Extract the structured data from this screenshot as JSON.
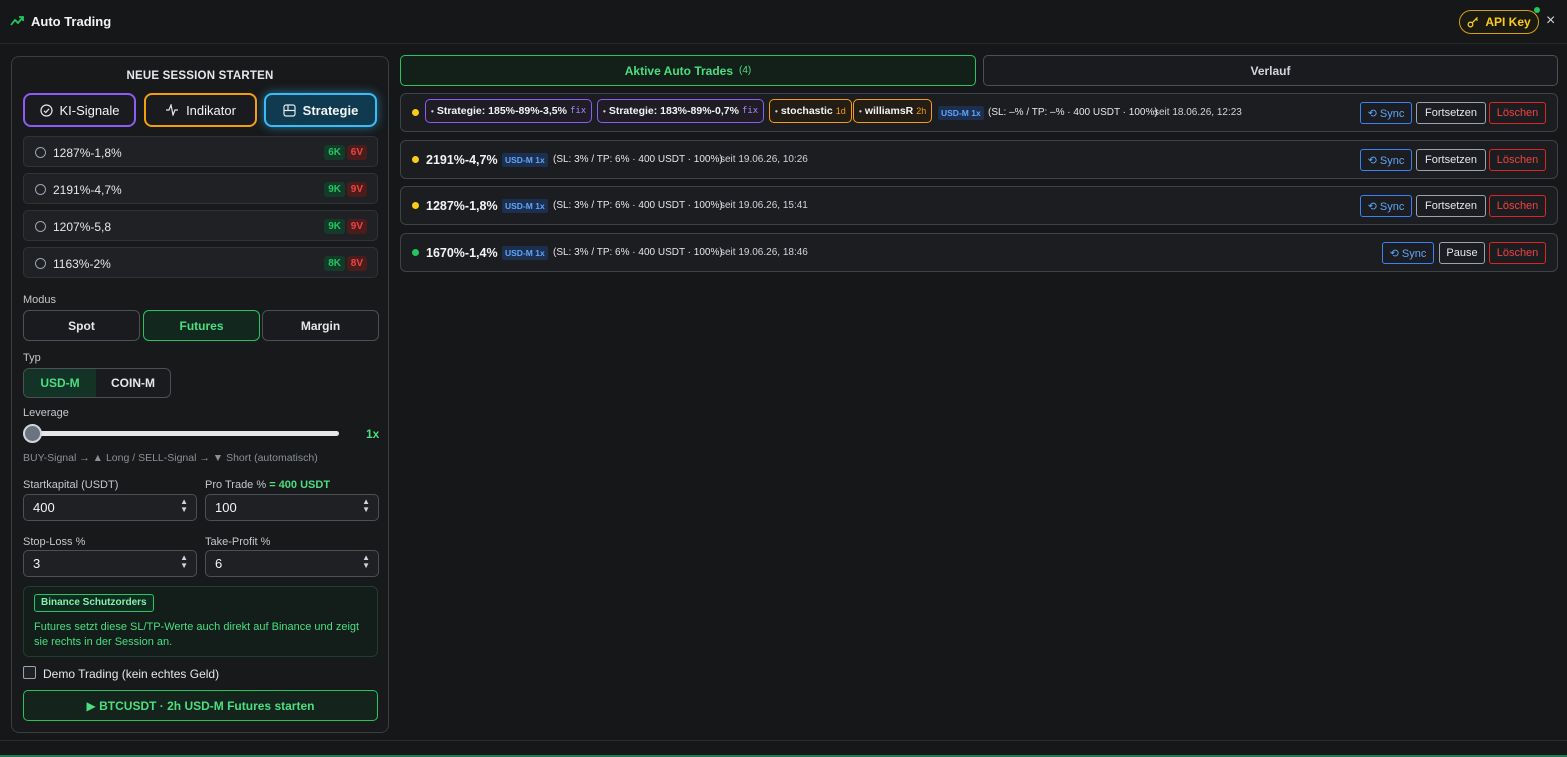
{
  "header": {
    "title": "Auto Trading",
    "api_key_label": "API Key",
    "close": "×"
  },
  "new_session": {
    "heading": "NEUE SESSION STARTEN",
    "sources": [
      "KI-Signale",
      "Indikator",
      "Strategie"
    ],
    "strategies": [
      {
        "label": "1287%-1,8%",
        "k": "6K",
        "v": "6V"
      },
      {
        "label": "2191%-4,7%",
        "k": "9K",
        "v": "9V"
      },
      {
        "label": "1207%-5,8",
        "k": "9K",
        "v": "9V"
      },
      {
        "label": "1163%-2%",
        "k": "8K",
        "v": "8V"
      }
    ],
    "modus_label": "Modus",
    "modes": [
      "Spot",
      "Futures",
      "Margin"
    ],
    "typ_label": "Typ",
    "types": [
      "USD-M",
      "COIN-M"
    ],
    "leverage_label": "Leverage",
    "leverage_value": "1x",
    "leverage_level": 1,
    "hint": "BUY-Signal → ▲ Long / SELL-Signal → ▼ Short (automatisch)",
    "startkapital_label": "Startkapital (USDT)",
    "startkapital_value": "400",
    "pro_trade_label": "Pro Trade %",
    "pro_trade_extra": "= 400 USDT",
    "pro_trade_value": "100",
    "stop_loss_label": "Stop-Loss %",
    "stop_loss_value": "3",
    "take_profit_label": "Take-Profit %",
    "take_profit_value": "6",
    "info_badge": "Binance Schutzorders",
    "info_text": "Futures setzt diese SL/TP-Werte auch direkt auf Binance und zeigt sie rechts in der Session an.",
    "demo_label": "Demo Trading (kein echtes Geld)",
    "start_button": "▶ BTCUSDT · 2h USD-M Futures starten"
  },
  "tabs": {
    "active_label": "Aktive Auto Trades",
    "active_count": "(4)",
    "history_label": "Verlauf"
  },
  "trades": [
    {
      "chips": [
        {
          "label": "Strategie: 185%-89%-3,5%",
          "suffix": "fix"
        },
        {
          "label": "Strategie: 183%-89%-0,7%",
          "suffix": "fix"
        },
        {
          "label": "stochastic",
          "suffix": "1d"
        },
        {
          "label": "williamsR",
          "suffix": "2h"
        }
      ],
      "market": "USD-M 1x",
      "params": "(SL: –% / TP: –% · 400 USDT · 100%)",
      "since": "seit 18.06.26, 12:23",
      "actions": [
        "⟲ Sync",
        "Fortsetzen",
        "Löschen"
      ],
      "status_color": "#facc15"
    },
    {
      "name": "2191%-4,7%",
      "market": "USD-M 1x",
      "params": "(SL: 3% / TP: 6% · 400 USDT · 100%)",
      "since": "seit 19.06.26, 10:26",
      "actions": [
        "⟲ Sync",
        "Fortsetzen",
        "Löschen"
      ],
      "status_color": "#facc15"
    },
    {
      "name": "1287%-1,8%",
      "market": "USD-M 1x",
      "params": "(SL: 3% / TP: 6% · 400 USDT · 100%)",
      "since": "seit 19.06.26, 15:41",
      "actions": [
        "⟲ Sync",
        "Fortsetzen",
        "Löschen"
      ],
      "status_color": "#facc15"
    },
    {
      "name": "1670%-1,4%",
      "market": "USD-M 1x",
      "params": "(SL: 3% / TP: 6% · 400 USDT · 100%)",
      "since": "seit 19.06.26, 18:46",
      "actions": [
        "⟲ Sync",
        "Pause",
        "Löschen"
      ],
      "status_color": "#22c55e"
    }
  ],
  "colors": {
    "accent": "#22c55e",
    "warning": "#facc15",
    "danger": "#ef4444",
    "info": "#3b82f6"
  }
}
